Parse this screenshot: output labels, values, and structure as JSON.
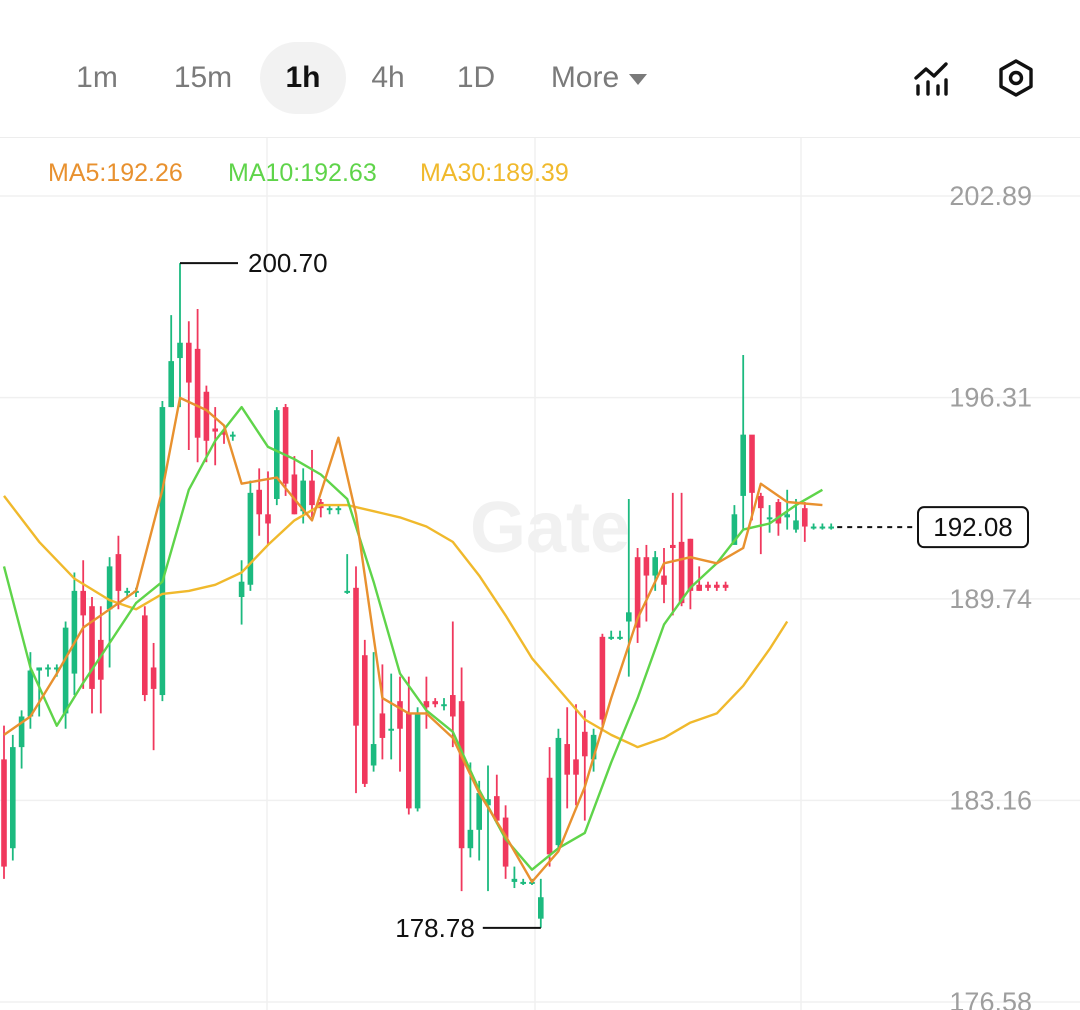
{
  "toolbar": {
    "tabs": [
      {
        "label": "1m",
        "active": false
      },
      {
        "label": "15m",
        "active": false
      },
      {
        "label": "1h",
        "active": true
      },
      {
        "label": "4h",
        "active": false
      },
      {
        "label": "1D",
        "active": false
      }
    ],
    "more_label": "More",
    "icons": [
      "indicators-icon",
      "settings-icon"
    ]
  },
  "chart_data": {
    "type": "candlestick",
    "interval": "1h",
    "watermark": "Gate",
    "legend": [
      {
        "label": "MA5:192.26",
        "color": "#e8912f"
      },
      {
        "label": "MA10:192.63",
        "color": "#5fd44a"
      },
      {
        "label": "MA30:189.39",
        "color": "#f0b92c"
      }
    ],
    "y_ticks": [
      202.89,
      196.31,
      189.74,
      183.16,
      176.58
    ],
    "y_range": [
      176.58,
      202.89
    ],
    "high_marker": "200.70",
    "low_marker": "178.78",
    "last_price": "192.08",
    "colors": {
      "up": "#1cba7f",
      "down": "#f0385d",
      "grid": "#f0f0f0",
      "axis_text": "#9e9e9e"
    },
    "candles": [
      [
        184.5,
        185.6,
        180.6,
        181.0
      ],
      [
        181.6,
        185.3,
        181.2,
        184.9
      ],
      [
        184.9,
        186.1,
        184.2,
        185.9
      ],
      [
        185.9,
        188.0,
        185.5,
        187.4
      ],
      [
        187.4,
        187.5,
        185.9,
        187.5
      ],
      [
        187.5,
        187.6,
        187.2,
        187.5
      ],
      [
        187.5,
        187.6,
        187.2,
        187.5
      ],
      [
        186.0,
        189.0,
        185.5,
        188.8
      ],
      [
        187.3,
        190.6,
        186.6,
        190.0
      ],
      [
        190.0,
        191.0,
        186.8,
        189.2
      ],
      [
        189.5,
        189.8,
        186.0,
        186.8
      ],
      [
        188.4,
        189.5,
        186.0,
        187.1
      ],
      [
        189.4,
        191.1,
        187.5,
        190.8
      ],
      [
        191.2,
        191.8,
        189.4,
        190.0
      ],
      [
        190.0,
        190.1,
        189.8,
        190.0
      ],
      [
        190.0,
        190.1,
        189.8,
        190.0
      ],
      [
        189.2,
        189.5,
        186.4,
        186.6
      ],
      [
        187.5,
        188.3,
        184.8,
        186.8
      ],
      [
        186.6,
        196.2,
        186.4,
        196.0
      ],
      [
        196.0,
        199.0,
        196.0,
        197.5
      ],
      [
        197.6,
        200.7,
        196.0,
        198.1
      ],
      [
        198.1,
        198.8,
        194.6,
        196.8
      ],
      [
        197.9,
        199.2,
        194.2,
        195.0
      ],
      [
        196.5,
        196.7,
        194.2,
        194.9
      ],
      [
        195.3,
        196.0,
        194.1,
        195.2
      ],
      [
        195.2,
        195.3,
        194.8,
        195.1
      ],
      [
        195.1,
        195.2,
        194.9,
        195.1
      ],
      [
        189.8,
        191.0,
        188.9,
        190.3
      ],
      [
        190.2,
        193.6,
        190.0,
        193.2
      ],
      [
        193.3,
        194.0,
        191.8,
        192.5
      ],
      [
        192.5,
        193.9,
        191.5,
        192.2
      ],
      [
        193.0,
        196.0,
        192.8,
        195.9
      ],
      [
        196.0,
        196.1,
        193.1,
        193.5
      ],
      [
        193.8,
        194.4,
        192.5,
        192.5
      ],
      [
        192.6,
        194.0,
        192.2,
        193.6
      ],
      [
        193.6,
        194.6,
        192.4,
        192.8
      ],
      [
        192.9,
        193.0,
        192.4,
        192.7
      ],
      [
        192.7,
        192.8,
        192.5,
        192.7
      ],
      [
        192.7,
        192.8,
        192.5,
        192.7
      ],
      [
        190.0,
        191.2,
        189.9,
        190.0
      ],
      [
        190.1,
        190.8,
        183.4,
        185.6
      ],
      [
        187.9,
        188.4,
        183.6,
        183.7
      ],
      [
        184.3,
        188.0,
        184.1,
        185.0
      ],
      [
        186.0,
        187.6,
        184.5,
        185.2
      ],
      [
        185.5,
        187.3,
        184.5,
        185.5
      ],
      [
        186.4,
        187.2,
        184.1,
        185.5
      ],
      [
        186.0,
        187.2,
        182.7,
        182.9
      ],
      [
        182.9,
        186.2,
        182.8,
        186.0
      ],
      [
        186.4,
        187.2,
        185.5,
        186.2
      ],
      [
        186.4,
        186.5,
        186.2,
        186.3
      ],
      [
        186.3,
        186.5,
        186.1,
        186.3
      ],
      [
        186.6,
        189.0,
        184.9,
        185.9
      ],
      [
        186.4,
        187.5,
        180.2,
        181.6
      ],
      [
        181.6,
        184.4,
        181.3,
        182.2
      ],
      [
        182.2,
        183.8,
        181.2,
        183.4
      ],
      [
        183.0,
        184.3,
        180.2,
        183.2
      ],
      [
        183.3,
        184.0,
        182.4,
        182.5
      ],
      [
        182.6,
        183.0,
        180.6,
        181.0
      ],
      [
        180.5,
        181.0,
        180.3,
        180.6
      ],
      [
        180.5,
        180.6,
        180.4,
        180.5
      ],
      [
        180.5,
        180.6,
        180.4,
        180.5
      ],
      [
        179.3,
        180.6,
        179.0,
        180.0
      ],
      [
        183.9,
        184.9,
        181.0,
        181.4
      ],
      [
        181.7,
        185.5,
        181.5,
        185.2
      ],
      [
        185.0,
        186.2,
        182.9,
        184.0
      ],
      [
        184.5,
        186.3,
        183.0,
        184.0
      ],
      [
        185.4,
        186.1,
        182.5,
        184.6
      ],
      [
        184.5,
        185.5,
        184.1,
        185.3
      ],
      [
        188.5,
        188.6,
        185.6,
        185.8
      ],
      [
        188.5,
        188.7,
        188.4,
        188.5
      ],
      [
        188.5,
        188.7,
        188.4,
        188.5
      ],
      [
        189.0,
        193.0,
        187.2,
        189.3
      ],
      [
        191.1,
        191.4,
        188.3,
        188.8
      ],
      [
        191.1,
        191.5,
        189.0,
        190.5
      ],
      [
        190.5,
        191.3,
        190.0,
        191.1
      ],
      [
        190.5,
        191.4,
        189.6,
        190.2
      ],
      [
        191.5,
        193.2,
        189.2,
        191.4
      ],
      [
        191.6,
        193.2,
        189.5,
        189.6
      ],
      [
        191.7,
        191.7,
        189.4,
        190.0
      ],
      [
        190.2,
        190.8,
        190.0,
        190.0
      ],
      [
        190.2,
        190.3,
        190.0,
        190.1
      ],
      [
        190.2,
        190.3,
        190.0,
        190.1
      ],
      [
        190.2,
        190.3,
        190.0,
        190.1
      ],
      [
        191.5,
        192.8,
        192.0,
        192.5
      ],
      [
        193.1,
        197.7,
        192.0,
        195.1
      ],
      [
        195.1,
        195.0,
        192.3,
        193.2
      ],
      [
        193.1,
        193.2,
        191.2,
        192.7
      ],
      [
        192.4,
        192.8,
        191.9,
        192.4
      ],
      [
        192.9,
        193.0,
        191.8,
        192.2
      ],
      [
        192.4,
        193.3,
        192.0,
        192.5
      ],
      [
        192.0,
        193.0,
        191.9,
        192.3
      ],
      [
        192.7,
        192.9,
        191.6,
        192.1
      ],
      [
        192.1,
        192.2,
        192.0,
        192.1
      ],
      [
        192.1,
        192.2,
        192.0,
        192.1
      ],
      [
        192.1,
        192.2,
        192.0,
        192.1
      ]
    ],
    "ma5": [
      [
        0.0,
        185.3
      ],
      [
        3.0,
        185.9
      ],
      [
        6.0,
        187.3
      ],
      [
        9.0,
        188.8
      ],
      [
        12.0,
        189.4
      ],
      [
        15.0,
        190.0
      ],
      [
        18.0,
        193.3
      ],
      [
        20.0,
        196.3
      ],
      [
        23.0,
        195.9
      ],
      [
        25.0,
        195.4
      ],
      [
        27.0,
        193.5
      ],
      [
        31.0,
        193.7
      ],
      [
        35.0,
        192.3
      ],
      [
        38.0,
        195.0
      ],
      [
        40.0,
        192.5
      ],
      [
        43.0,
        186.5
      ],
      [
        46.0,
        186.0
      ],
      [
        48.0,
        186.0
      ],
      [
        51.0,
        185.2
      ],
      [
        54.0,
        183.4
      ],
      [
        57.0,
        182.0
      ],
      [
        60.0,
        180.5
      ],
      [
        63.0,
        181.5
      ],
      [
        66.0,
        183.6
      ],
      [
        69.0,
        186.5
      ],
      [
        72.0,
        189.1
      ],
      [
        75.0,
        190.9
      ],
      [
        78.0,
        191.1
      ],
      [
        81.0,
        190.9
      ],
      [
        84.0,
        191.4
      ],
      [
        86.0,
        193.5
      ],
      [
        89.0,
        192.9
      ],
      [
        93.0,
        192.8
      ]
    ],
    "ma10": [
      [
        0.0,
        190.8
      ],
      [
        3.0,
        187.5
      ],
      [
        6.0,
        185.6
      ],
      [
        9.0,
        187.0
      ],
      [
        12.0,
        188.3
      ],
      [
        15.0,
        189.6
      ],
      [
        18.0,
        190.3
      ],
      [
        21.0,
        193.3
      ],
      [
        24.0,
        194.9
      ],
      [
        27.0,
        196.0
      ],
      [
        30.0,
        194.7
      ],
      [
        33.0,
        194.3
      ],
      [
        36.0,
        193.8
      ],
      [
        39.0,
        193.0
      ],
      [
        42.0,
        190.3
      ],
      [
        45.0,
        187.3
      ],
      [
        48.0,
        186.1
      ],
      [
        51.0,
        185.4
      ],
      [
        54.0,
        183.5
      ],
      [
        57.0,
        181.9
      ],
      [
        60.0,
        180.9
      ],
      [
        63.0,
        181.6
      ],
      [
        66.0,
        182.1
      ],
      [
        69.0,
        184.4
      ],
      [
        72.0,
        186.5
      ],
      [
        75.0,
        188.9
      ],
      [
        78.0,
        190.1
      ],
      [
        81.0,
        190.9
      ],
      [
        84.0,
        192.0
      ],
      [
        87.0,
        192.2
      ],
      [
        90.0,
        192.8
      ],
      [
        93.0,
        193.3
      ]
    ],
    "ma30": [
      [
        0.0,
        193.1
      ],
      [
        4.0,
        191.6
      ],
      [
        8.0,
        190.4
      ],
      [
        12.0,
        189.7
      ],
      [
        15.0,
        189.4
      ],
      [
        18.0,
        189.9
      ],
      [
        21.0,
        190.0
      ],
      [
        24.0,
        190.2
      ],
      [
        27.0,
        190.6
      ],
      [
        30.0,
        191.5
      ],
      [
        33.0,
        192.3
      ],
      [
        36.0,
        192.8
      ],
      [
        39.0,
        192.8
      ],
      [
        42.0,
        192.6
      ],
      [
        45.0,
        192.4
      ],
      [
        48.0,
        192.1
      ],
      [
        51.0,
        191.6
      ],
      [
        54.0,
        190.5
      ],
      [
        57.0,
        189.2
      ],
      [
        60.0,
        187.8
      ],
      [
        63.0,
        186.8
      ],
      [
        66.0,
        185.8
      ],
      [
        69.0,
        185.3
      ],
      [
        72.0,
        184.9
      ],
      [
        75.0,
        185.2
      ],
      [
        78.0,
        185.7
      ],
      [
        81.0,
        186.0
      ],
      [
        84.0,
        186.9
      ],
      [
        87.0,
        188.1
      ],
      [
        89.0,
        189.0
      ]
    ]
  }
}
